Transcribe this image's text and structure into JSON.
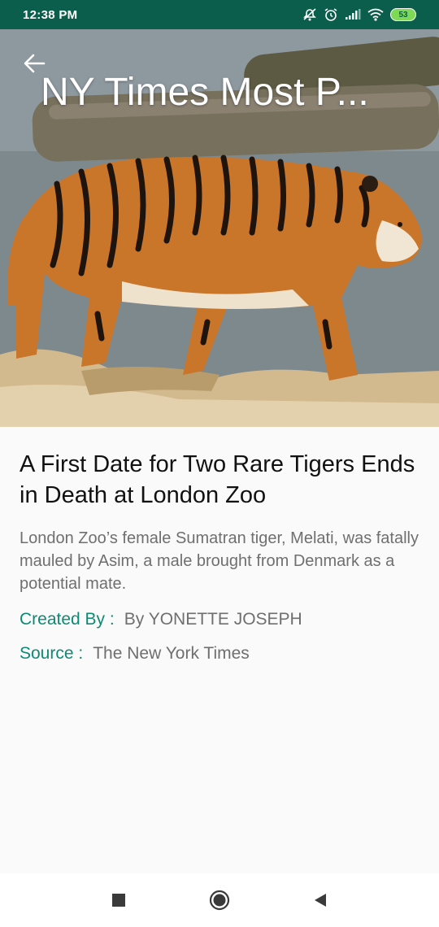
{
  "status_bar": {
    "time": "12:38 PM",
    "battery_level": "53",
    "icons": [
      "mute-icon",
      "alarm-icon",
      "signal-icon",
      "wifi-icon",
      "battery-icon"
    ]
  },
  "toolbar": {
    "title": "NY Times Most P...",
    "back_icon": "arrow-left-icon"
  },
  "article": {
    "headline": "A First Date for Two Rare Tigers Ends in Death at London Zoo",
    "abstract": "London Zoo’s female Sumatran tiger, Melati, was fatally mauled by Asim, a male brought from Denmark as a potential mate.",
    "created_by_label": "Created By :",
    "created_by_value": "By YONETTE JOSEPH",
    "source_label": "Source :",
    "source_value": "The New York Times"
  },
  "nav_bar": {
    "icons": [
      "recents-square-icon",
      "home-circle-icon",
      "back-triangle-icon"
    ]
  },
  "colors": {
    "status_bar": "#0b5e4c",
    "accent": "#0e8a74",
    "body_text": "#6f6f6f",
    "headline_text": "#111111",
    "background": "#fafafa"
  }
}
